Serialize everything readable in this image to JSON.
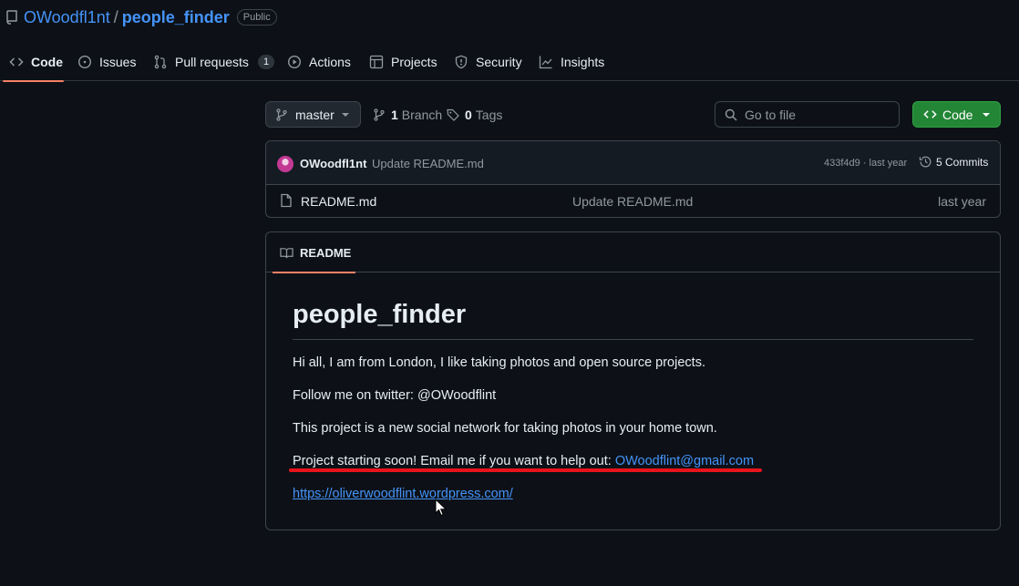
{
  "repo": {
    "owner": "OWoodfl1nt",
    "separator": "/",
    "name": "people_finder",
    "visibility": "Public"
  },
  "tabs": [
    {
      "label": "Code",
      "icon": "code-icon",
      "active": true
    },
    {
      "label": "Issues",
      "icon": "issue-icon"
    },
    {
      "label": "Pull requests",
      "icon": "pull-request-icon",
      "count": "1"
    },
    {
      "label": "Actions",
      "icon": "play-icon"
    },
    {
      "label": "Projects",
      "icon": "table-icon"
    },
    {
      "label": "Security",
      "icon": "shield-icon"
    },
    {
      "label": "Insights",
      "icon": "graph-icon"
    }
  ],
  "toolbar": {
    "branch": "master",
    "branch_count": "1",
    "branch_label": "Branch",
    "tag_count": "0",
    "tag_label": "Tags",
    "search_placeholder": "Go to file",
    "code_button": "Code"
  },
  "latest_commit": {
    "author": "OWoodfl1nt",
    "message": "Update README.md",
    "hash_time": "433f4d9 · last year",
    "commits_label": "5 Commits"
  },
  "files": [
    {
      "name": "README.md",
      "commit": "Update README.md",
      "time": "last year",
      "icon": "file-icon"
    }
  ],
  "readme": {
    "tab_label": "README",
    "title": "people_finder",
    "p1": "Hi all, I am from London, I like taking photos and open source projects.",
    "p2": "Follow me on twitter: @OWoodflint",
    "p3": "This project is a new social network for taking photos in your home town.",
    "p4_text": "Project starting soon! Email me if you want to help out: ",
    "p4_email": "OWoodflint@gmail.com",
    "link": "https://oliverwoodflint.wordpress.com/"
  },
  "colors": {
    "background": "#0d1117",
    "link": "#4493f8",
    "accent_tab": "#f78166",
    "code_button": "#238636",
    "highlight": "#e8131b"
  }
}
